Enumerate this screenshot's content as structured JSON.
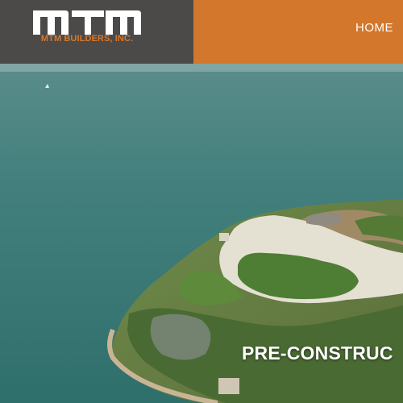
{
  "header": {
    "logo_mark": "MTM",
    "company_name": "MTM BUILDERS, INC.",
    "nav_home": "HOME"
  },
  "hero": {
    "caption": "PRE-CONSTRUC"
  },
  "colors": {
    "header_dark": "#4b4a49",
    "header_orange": "#d2772b",
    "logo_orange": "#d8782b",
    "sea": "#3f7a76"
  }
}
